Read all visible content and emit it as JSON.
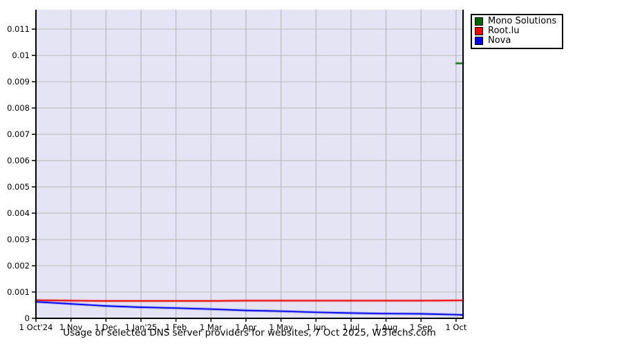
{
  "chart_data": {
    "type": "line",
    "title": "Usage of selected DNS server providers for websites, 7 Oct 2025, W3Techs.com",
    "xlabel": "",
    "ylabel": "",
    "x_tick_labels": [
      "1 Oct'24",
      "1 Nov",
      "1 Dec",
      "1 Jan'25",
      "1 Feb",
      "1 Mar",
      "1 Apr",
      "1 May",
      "1 Jun",
      "1 Jul",
      "1 Aug",
      "1 Sep",
      "1 Oct"
    ],
    "y_ticks": [
      0,
      0.001,
      0.002,
      0.003,
      0.004,
      0.005,
      0.006,
      0.007,
      0.008,
      0.009,
      0.01,
      0.011
    ],
    "y_tick_labels": [
      "0",
      "0.001",
      "0.002",
      "0.003",
      "0.004",
      "0.005",
      "0.006",
      "0.007",
      "0.008",
      "0.009",
      "0.01",
      "0.011"
    ],
    "ylim": [
      0,
      0.01174
    ],
    "xlim": [
      0,
      12.2
    ],
    "grid": true,
    "legend_position": "top-right-outside",
    "plot_bg_color": "#e4e4f4",
    "grid_color_h": "#c2c2c6",
    "grid_color_v": "#b8b8c0",
    "axis_color": "#000000",
    "x": [
      0,
      1,
      2,
      3,
      4,
      5,
      6,
      7,
      8,
      9,
      10,
      11,
      12,
      12.2
    ],
    "series": [
      {
        "name": "Mono Solutions",
        "color": "#006400",
        "values": [
          null,
          null,
          null,
          null,
          null,
          null,
          null,
          null,
          null,
          null,
          null,
          null,
          0.0097,
          0.0097
        ]
      },
      {
        "name": "Root.lu",
        "color": "#ee0000",
        "swatch_color": "#ff0000",
        "values": [
          0.00069,
          0.00067,
          0.00066,
          0.00066,
          0.00066,
          0.00066,
          0.00067,
          0.00067,
          0.00067,
          0.00067,
          0.00067,
          0.00067,
          0.00068,
          0.00068
        ]
      },
      {
        "name": "Nova",
        "color": "#0000ee",
        "swatch_color": "#0000ff",
        "values": [
          0.00063,
          0.00055,
          0.00047,
          0.00042,
          0.00039,
          0.00035,
          0.0003,
          0.00027,
          0.00023,
          0.0002,
          0.00018,
          0.00017,
          0.00014,
          0.00013
        ]
      }
    ]
  }
}
